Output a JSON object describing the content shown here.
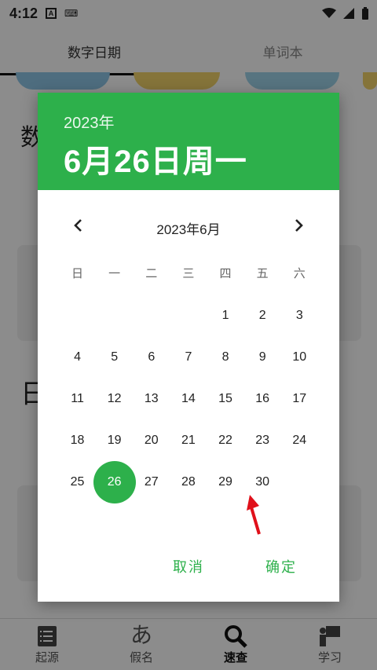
{
  "status": {
    "time": "4:12"
  },
  "tabs": [
    {
      "label": "数字日期"
    },
    {
      "label": "单词本"
    }
  ],
  "background": {
    "heading1": "数",
    "heading2": "日"
  },
  "dialog": {
    "header_year": "2023年",
    "header_date": "6月26日周一",
    "month_title": "2023年6月",
    "weekdays": [
      "日",
      "一",
      "二",
      "三",
      "四",
      "五",
      "六"
    ],
    "weeks": [
      [
        "",
        "",
        "",
        "",
        "1",
        "2",
        "3"
      ],
      [
        "4",
        "5",
        "6",
        "7",
        "8",
        "9",
        "10"
      ],
      [
        "11",
        "12",
        "13",
        "14",
        "15",
        "16",
        "17"
      ],
      [
        "18",
        "19",
        "20",
        "21",
        "22",
        "23",
        "24"
      ],
      [
        "25",
        "26",
        "27",
        "28",
        "29",
        "30",
        ""
      ]
    ],
    "selected_day": "26",
    "cancel_label": "取消",
    "ok_label": "确定"
  },
  "bottom_nav": [
    {
      "label": "起源",
      "icon": "list-icon"
    },
    {
      "label": "假名",
      "icon": "kana-icon"
    },
    {
      "label": "速查",
      "icon": "search-icon"
    },
    {
      "label": "学习",
      "icon": "study-icon"
    }
  ],
  "colors": {
    "accent": "#2db04b",
    "annotation_arrow": "#e0101a"
  }
}
